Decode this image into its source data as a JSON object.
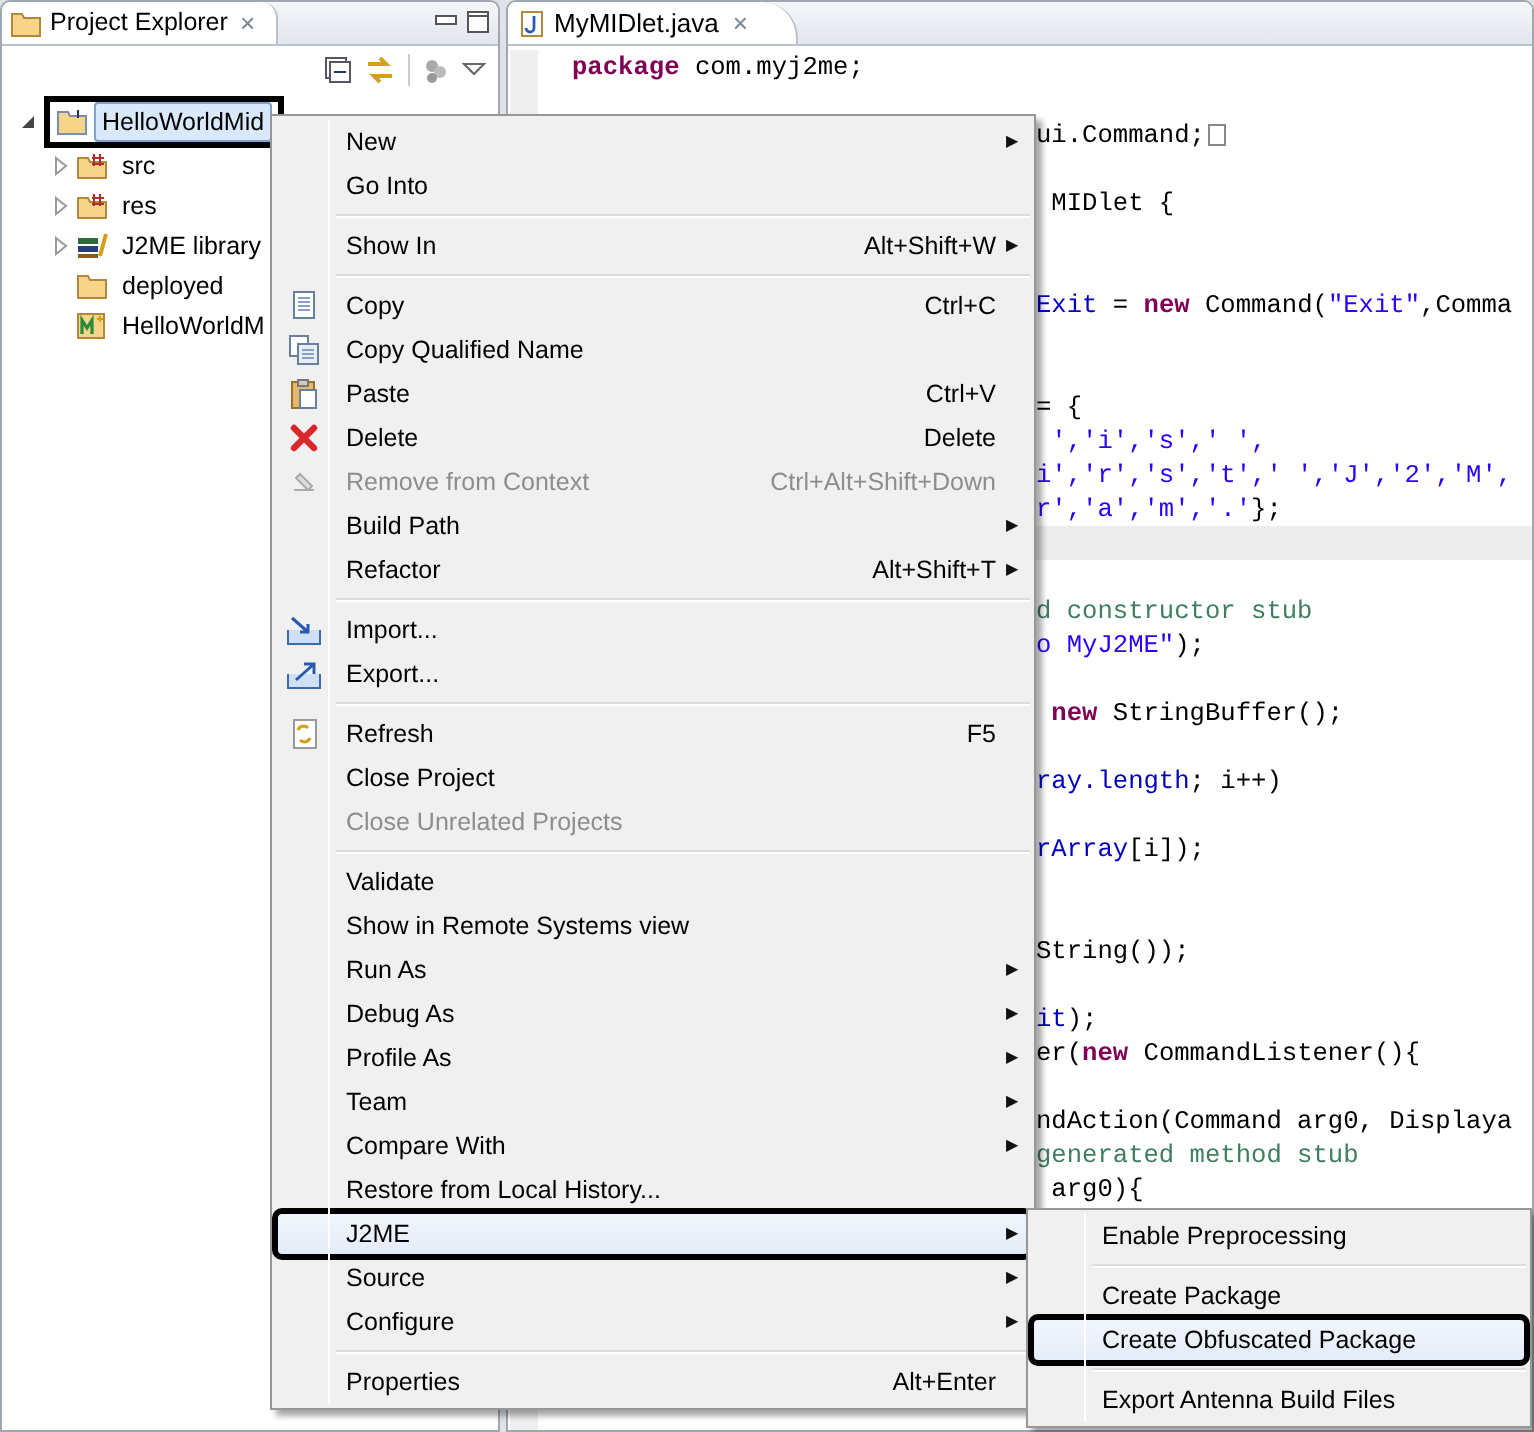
{
  "explorer": {
    "title": "Project Explorer",
    "close": "×",
    "tree": [
      {
        "label": "HelloWorldMid",
        "kind": "project",
        "selected": true,
        "expanded": true,
        "children": [
          {
            "label": "src",
            "kind": "source-folder",
            "selected": false,
            "expanded": false
          },
          {
            "label": "res",
            "kind": "source-folder",
            "selected": false,
            "expanded": false
          },
          {
            "label": "J2ME library",
            "kind": "library",
            "selected": false,
            "expanded": false
          },
          {
            "label": "deployed",
            "kind": "folder",
            "selected": false
          },
          {
            "label": "HelloWorldM",
            "kind": "midlet",
            "selected": false
          }
        ]
      }
    ]
  },
  "editor": {
    "tab": {
      "label": "MyMIDlet.java",
      "close": "×",
      "selected": true
    },
    "lines": [
      {
        "kind": "code",
        "tokens": [
          {
            "kind": "keyword",
            "text": "package"
          },
          {
            "kind": "plain",
            "text": " com.myj2me;"
          }
        ]
      },
      {
        "kind": "blank"
      },
      {
        "kind": "clipped-folded",
        "tokens": [
          {
            "kind": "plain",
            "text": "ui.Command;"
          }
        ]
      },
      {
        "kind": "blank"
      },
      {
        "kind": "clipped",
        "tokens": [
          {
            "kind": "plain",
            "text": " MIDlet {"
          }
        ]
      },
      {
        "kind": "blank"
      },
      {
        "kind": "blank"
      },
      {
        "kind": "clipped",
        "tokens": [
          {
            "kind": "field",
            "text": "Exit"
          },
          {
            "kind": "plain",
            "text": " = "
          },
          {
            "kind": "keyword",
            "text": "new"
          },
          {
            "kind": "plain",
            "text": " Command("
          },
          {
            "kind": "string",
            "text": "\"Exit\""
          },
          {
            "kind": "plain",
            "text": ",Comma"
          }
        ]
      },
      {
        "kind": "blank"
      },
      {
        "kind": "blank"
      },
      {
        "kind": "clipped",
        "tokens": [
          {
            "kind": "plain",
            "text": "= {"
          }
        ]
      },
      {
        "kind": "clipped",
        "tokens": [
          {
            "kind": "string",
            "text": " ','i','s',' ',"
          }
        ]
      },
      {
        "kind": "clipped",
        "tokens": [
          {
            "kind": "string",
            "text": "i','r','s','t',' ','J','2','M',"
          }
        ]
      },
      {
        "kind": "clipped",
        "tokens": [
          {
            "kind": "string",
            "text": "r','a','m','.'"
          },
          {
            "kind": "plain",
            "text": "};"
          }
        ]
      },
      {
        "kind": "current"
      },
      {
        "kind": "blank"
      },
      {
        "kind": "clipped",
        "tokens": [
          {
            "kind": "comment",
            "text": "d constructor stub"
          }
        ]
      },
      {
        "kind": "clipped",
        "tokens": [
          {
            "kind": "string",
            "text": "o MyJ2ME\""
          },
          {
            "kind": "plain",
            "text": ");"
          }
        ]
      },
      {
        "kind": "blank"
      },
      {
        "kind": "clipped",
        "tokens": [
          {
            "kind": "keyword",
            "text": " new"
          },
          {
            "kind": "plain",
            "text": " StringBuffer();"
          }
        ]
      },
      {
        "kind": "blank"
      },
      {
        "kind": "clipped",
        "tokens": [
          {
            "kind": "field",
            "text": "ray.length"
          },
          {
            "kind": "plain",
            "text": "; i++)"
          }
        ]
      },
      {
        "kind": "blank"
      },
      {
        "kind": "clipped",
        "tokens": [
          {
            "kind": "field",
            "text": "rArray"
          },
          {
            "kind": "plain",
            "text": "[i]);"
          }
        ]
      },
      {
        "kind": "blank"
      },
      {
        "kind": "blank"
      },
      {
        "kind": "clipped",
        "tokens": [
          {
            "kind": "plain",
            "text": "String());"
          }
        ]
      },
      {
        "kind": "blank"
      },
      {
        "kind": "clipped",
        "tokens": [
          {
            "kind": "field",
            "text": "it"
          },
          {
            "kind": "plain",
            "text": ");"
          }
        ]
      },
      {
        "kind": "clipped",
        "tokens": [
          {
            "kind": "plain",
            "text": "er("
          },
          {
            "kind": "keyword",
            "text": "new"
          },
          {
            "kind": "plain",
            "text": " CommandListener(){"
          }
        ]
      },
      {
        "kind": "blank"
      },
      {
        "kind": "clipped",
        "tokens": [
          {
            "kind": "plain",
            "text": "ndAction(Command arg0, Displaya"
          }
        ]
      },
      {
        "kind": "clipped",
        "tokens": [
          {
            "kind": "comment",
            "text": "generated method stub"
          }
        ]
      },
      {
        "kind": "clipped",
        "tokens": [
          {
            "kind": "plain",
            "text": " arg0){"
          }
        ]
      }
    ]
  },
  "context_menu": {
    "sections": [
      [
        {
          "label": "New",
          "arrow": "▶",
          "disabled": false,
          "selected": false
        },
        {
          "label": "Go Into",
          "disabled": false,
          "selected": false
        }
      ],
      [
        {
          "label": "Show In",
          "shortcut": "Alt+Shift+W",
          "arrow": "▶",
          "disabled": false,
          "selected": false
        }
      ],
      [
        {
          "label": "Copy",
          "shortcut": "Ctrl+C",
          "disabled": false,
          "selected": false
        },
        {
          "label": "Copy Qualified Name",
          "disabled": false,
          "selected": false
        },
        {
          "label": "Paste",
          "shortcut": "Ctrl+V",
          "disabled": false,
          "selected": false
        },
        {
          "label": "Delete",
          "shortcut": "Delete",
          "disabled": false,
          "selected": false
        },
        {
          "label": "Remove from Context",
          "shortcut": "Ctrl+Alt+Shift+Down",
          "disabled": true,
          "selected": false
        },
        {
          "label": "Build Path",
          "arrow": "▶",
          "disabled": false,
          "selected": false
        },
        {
          "label": "Refactor",
          "shortcut": "Alt+Shift+T",
          "arrow": "▶",
          "disabled": false,
          "selected": false
        }
      ],
      [
        {
          "label": "Import...",
          "disabled": false,
          "selected": false
        },
        {
          "label": "Export...",
          "disabled": false,
          "selected": false
        }
      ],
      [
        {
          "label": "Refresh",
          "shortcut": "F5",
          "disabled": false,
          "selected": false
        },
        {
          "label": "Close Project",
          "disabled": false,
          "selected": false
        },
        {
          "label": "Close Unrelated Projects",
          "disabled": true,
          "selected": false
        }
      ],
      [
        {
          "label": "Validate",
          "disabled": false,
          "selected": false
        },
        {
          "label": "Show in Remote Systems view",
          "disabled": false,
          "selected": false
        },
        {
          "label": "Run As",
          "arrow": "▶",
          "disabled": false,
          "selected": false
        },
        {
          "label": "Debug As",
          "arrow": "▶",
          "disabled": false,
          "selected": false
        },
        {
          "label": "Profile As",
          "arrow": "▶",
          "disabled": false,
          "selected": false
        },
        {
          "label": "Team",
          "arrow": "▶",
          "disabled": false,
          "selected": false
        },
        {
          "label": "Compare With",
          "arrow": "▶",
          "disabled": false,
          "selected": false
        },
        {
          "label": "Restore from Local History...",
          "disabled": false,
          "selected": false
        },
        {
          "label": "J2ME",
          "arrow": "▶",
          "disabled": false,
          "selected": true
        },
        {
          "label": "Source",
          "arrow": "▶",
          "disabled": false,
          "selected": false
        },
        {
          "label": "Configure",
          "arrow": "▶",
          "disabled": false,
          "selected": false
        }
      ],
      [
        {
          "label": "Properties",
          "shortcut": "Alt+Enter",
          "disabled": false,
          "selected": false
        }
      ]
    ]
  },
  "submenu": {
    "sections": [
      [
        {
          "label": "Enable Preprocessing",
          "disabled": false,
          "selected": false
        }
      ],
      [
        {
          "label": "Create Package",
          "disabled": false,
          "selected": false
        },
        {
          "label": "Create Obfuscated Package",
          "disabled": false,
          "selected": true
        }
      ],
      [
        {
          "label": "Export Antenna Build Files",
          "disabled": false,
          "selected": false
        }
      ]
    ]
  }
}
